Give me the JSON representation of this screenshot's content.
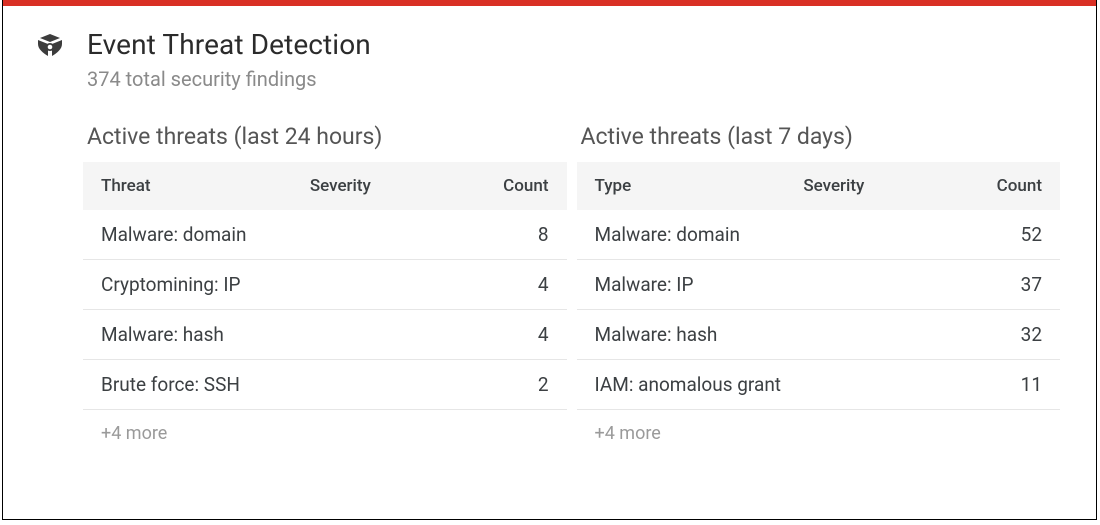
{
  "header": {
    "title": "Event Threat Detection",
    "subtitle": "374 total security findings"
  },
  "panels": {
    "left": {
      "title": "Active threats (last 24 hours)",
      "columns": {
        "threat": "Threat",
        "severity": "Severity",
        "count": "Count"
      },
      "rows": [
        {
          "threat": "Malware: domain",
          "severity": "",
          "count": "8"
        },
        {
          "threat": "Cryptomining: IP",
          "severity": "",
          "count": "4"
        },
        {
          "threat": "Malware: hash",
          "severity": "",
          "count": "4"
        },
        {
          "threat": "Brute force: SSH",
          "severity": "",
          "count": "2"
        }
      ],
      "more_label": "+4 more"
    },
    "right": {
      "title": "Active threats (last 7 days)",
      "columns": {
        "type": "Type",
        "severity": "Severity",
        "count": "Count"
      },
      "rows": [
        {
          "threat": "Malware: domain",
          "severity": "",
          "count": "52"
        },
        {
          "threat": "Malware: IP",
          "severity": "",
          "count": "37"
        },
        {
          "threat": "Malware: hash",
          "severity": "",
          "count": "32"
        },
        {
          "threat": "IAM: anomalous grant",
          "severity": "",
          "count": "11"
        }
      ],
      "more_label": "+4 more"
    }
  }
}
